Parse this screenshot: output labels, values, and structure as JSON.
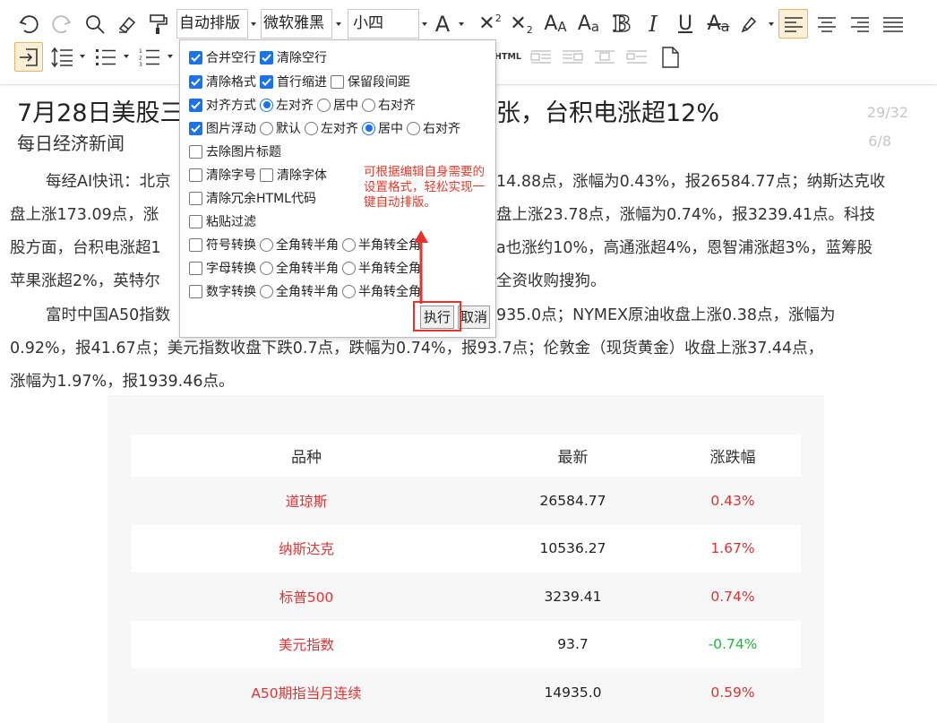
{
  "toolbar": {
    "autoformat": "自动排版",
    "font_family": "微软雅黑",
    "font_size": "小四",
    "font_a": "A",
    "html_label": "HTML",
    "superscript_mark": "2",
    "subscript_mark": "2",
    "bold_mark": "B",
    "italic_mark": "I",
    "underline_mark": "U",
    "font_size_mark_a": "A",
    "font_size_mark_b": "A",
    "font_size_mark_c": "A",
    "font_size_mark_d": "a",
    "font_size_mark_e": "A",
    "font_size_mark_f": "a"
  },
  "article": {
    "title": "7月28日美股三",
    "title_tail": "张，台积电涨超12%",
    "source": "每日经济新闻",
    "counter_top": "29/32",
    "counter_bottom": "6/8",
    "p1": [
      "每经AI快讯：北京",
      "14.88点，涨幅为0.43%，报26584.77点；纳斯达克收",
      "盘上涨173.09点，涨",
      "盘上涨23.78点，涨幅为0.74%，报3239.41点。科技",
      "股方面，台积电涨超1",
      "a也涨约10%，高通涨超4%，恩智浦涨超3%，蓝筹股",
      "苹果涨超2%，英特尔",
      "全资收购搜狗。"
    ],
    "p2": [
      "富时中国A50指数",
      "935.0点；NYMEX原油收盘上涨0.38点，涨幅为",
      "0.92%，报41.67点；美元指数收盘下跌0.7点，跌幅为0.74%，报93.7点；伦敦金（现货黄金）收盘上涨37.44点，",
      "涨幅为1.97%，报1939.46点。"
    ]
  },
  "market_table": {
    "headers": [
      "品种",
      "最新",
      "涨跌幅"
    ],
    "rows": [
      {
        "name": "道琼斯",
        "value": "26584.77",
        "change": "0.43%",
        "dir": "up"
      },
      {
        "name": "纳斯达克",
        "value": "10536.27",
        "change": "1.67%",
        "dir": "up"
      },
      {
        "name": "标普500",
        "value": "3239.41",
        "change": "0.74%",
        "dir": "up"
      },
      {
        "name": "美元指数",
        "value": "93.7",
        "change": "-0.74%",
        "dir": "down"
      },
      {
        "name": "A50期指当月连续",
        "value": "14935.0",
        "change": "0.59%",
        "dir": "up"
      }
    ]
  },
  "autoformat_panel": {
    "merge_blank_lines": "合并空行",
    "clear_blank_lines": "清除空行",
    "clear_format": "清除格式",
    "first_line_indent": "首行缩进",
    "keep_paragraph_spacing": "保留段间距",
    "alignment": "对齐方式",
    "align_left": "左对齐",
    "align_center": "居中",
    "align_right": "右对齐",
    "image_float": "图片浮动",
    "float_default": "默认",
    "float_left": "左对齐",
    "float_center": "居中",
    "float_right": "右对齐",
    "remove_image_title": "去除图片标题",
    "clear_font_size": "清除字号",
    "clear_font": "清除字体",
    "clear_redundant_html": "清除冗余HTML代码",
    "paste_filter": "粘贴过滤",
    "symbol_convert": "符号转换",
    "letter_convert": "字母转换",
    "number_convert": "数字转换",
    "full_to_half": "全角转半角",
    "half_to_full": "半角转全角",
    "execute": "执行",
    "cancel": "取消"
  },
  "annotation": {
    "text": "可根据编辑自身需要的设置格式，轻松实现一键自动排版。"
  },
  "colors": {
    "accent": "#1a73e8",
    "annotation_red": "#e7332c",
    "up_red": "#e0312f",
    "down_green": "#20b63a"
  }
}
